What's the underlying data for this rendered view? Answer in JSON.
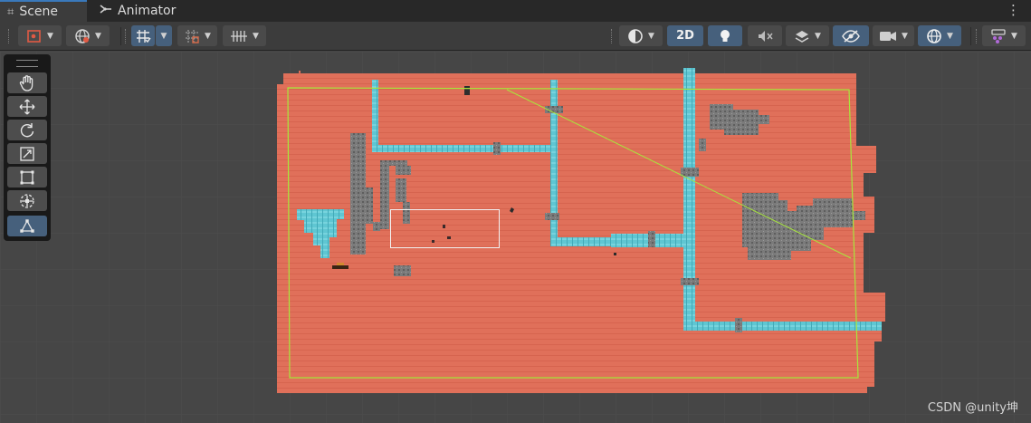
{
  "tabs": [
    {
      "label": "Scene",
      "icon": "grid-icon",
      "active": true
    },
    {
      "label": "Animator",
      "icon": "animator-icon",
      "active": false
    }
  ],
  "more_menu": "⋮",
  "toolbar": {
    "mode_2d_label": "2D",
    "active_accent": "#46607c"
  },
  "tools": [
    {
      "name": "hand-tool",
      "icon": "hand-icon",
      "active": false
    },
    {
      "name": "move-tool",
      "icon": "move-icon",
      "active": false
    },
    {
      "name": "rotate-tool",
      "icon": "rotate-icon",
      "active": false
    },
    {
      "name": "scale-tool",
      "icon": "scale-icon",
      "active": false
    },
    {
      "name": "rect-tool",
      "icon": "rect-transform-icon",
      "active": false
    },
    {
      "name": "transform-tool",
      "icon": "transform-icon",
      "active": false
    },
    {
      "name": "custom-tool",
      "icon": "custom-editor-tool-icon",
      "active": true
    }
  ],
  "scene": {
    "background": "#464646",
    "tilemap_floor_color": "#e0705a",
    "water_tile_color": "#5fc6d2",
    "wall_tile_color": "#7b7b7b",
    "camera_bounds_color": "#a8e63c"
  },
  "watermark": "CSDN @unity坤"
}
